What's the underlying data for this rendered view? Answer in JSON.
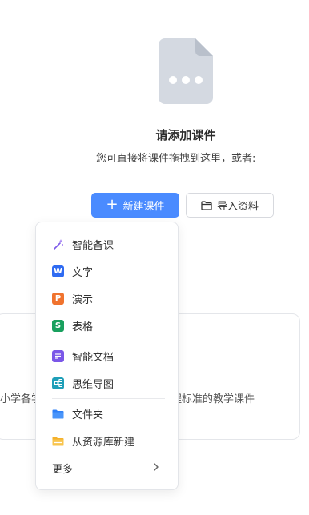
{
  "empty_state": {
    "icon": "file-icon",
    "title": "请添加课件",
    "subtitle": "您可直接将课件拖拽到这里，或者:"
  },
  "actions": {
    "new_label": "新建课件",
    "import_label": "导入资料"
  },
  "background": {
    "left_text": "小学各学",
    "right_text": "程标准的教学课件"
  },
  "menu": {
    "items": [
      {
        "label": "智能备课",
        "icon": "magic-wand-icon"
      },
      {
        "label": "文字",
        "icon": "word-doc-icon",
        "glyph": "W",
        "color": "#2f6bf2"
      },
      {
        "label": "演示",
        "icon": "presentation-icon",
        "glyph": "P",
        "color": "#f0732e"
      },
      {
        "label": "表格",
        "icon": "spreadsheet-icon",
        "glyph": "S",
        "color": "#19a05e"
      },
      {
        "label": "智能文档",
        "icon": "smart-doc-icon",
        "color": "#7b57e8"
      },
      {
        "label": "思维导图",
        "icon": "mindmap-icon",
        "color": "#1f9fb8"
      },
      {
        "label": "文件夹",
        "icon": "folder-icon",
        "color": "#2f80f7"
      },
      {
        "label": "从资源库新建",
        "icon": "resource-folder-icon",
        "color": "#f5b12a"
      },
      {
        "label": "更多",
        "icon": "chevron-right-icon"
      }
    ]
  }
}
